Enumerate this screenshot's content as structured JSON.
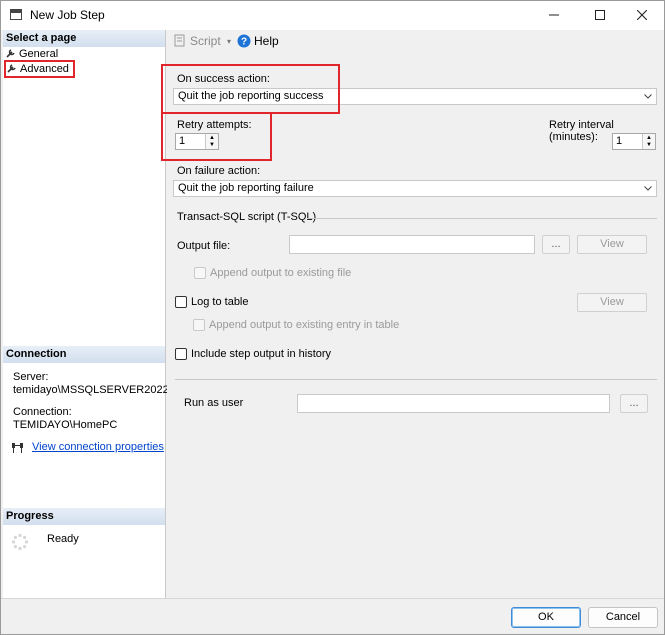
{
  "window": {
    "title": "New Job Step"
  },
  "left_pane": {
    "select_page_header": "Select a page",
    "pages": [
      {
        "label": "General"
      },
      {
        "label": "Advanced",
        "selected": true
      }
    ],
    "connection_header": "Connection",
    "server_label": "Server:",
    "server_value": "temidayo\\MSSQLSERVER2022",
    "connection_label": "Connection:",
    "connection_value": "TEMIDAYO\\HomePC",
    "view_connection_link": "View connection properties",
    "progress_header": "Progress",
    "progress_status": "Ready"
  },
  "toolbar": {
    "script_label": "Script",
    "help_label": "Help"
  },
  "form": {
    "on_success_label": "On success action:",
    "on_success_value": "Quit the job reporting success",
    "retry_attempts_label": "Retry attempts:",
    "retry_attempts_value": "1",
    "retry_interval_label": "Retry interval (minutes):",
    "retry_interval_value": "1",
    "on_failure_label": "On failure action:",
    "on_failure_value": "Quit the job reporting failure",
    "tsql_group_label": "Transact-SQL script (T-SQL)",
    "output_file_label": "Output file:",
    "browse_label": "...",
    "view_label": "View",
    "append_output_label": "Append output to existing file",
    "log_to_table_label": "Log to table",
    "append_table_label": "Append output to existing entry in table",
    "include_history_label": "Include step output in history",
    "run_as_user_label": "Run as user"
  },
  "buttons": {
    "ok": "OK",
    "cancel": "Cancel"
  },
  "colors": {
    "highlight": "#e0262b",
    "link": "#0044cc",
    "header_bg": "#d2dfee"
  }
}
